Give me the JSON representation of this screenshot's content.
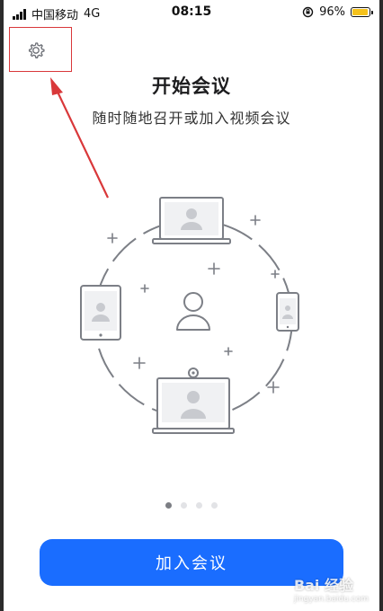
{
  "status_bar": {
    "carrier": "中国移动",
    "network": "4G",
    "time": "08:15",
    "battery_percent": "96%",
    "battery_level": 0.96
  },
  "header": {
    "settings_icon": "gear-icon"
  },
  "main": {
    "title": "开始会议",
    "subtitle": "随时随地召开或加入视频会议",
    "illustration_icons": [
      "laptop-icon",
      "tablet-icon",
      "phone-icon",
      "room-system-icon",
      "user-icon"
    ],
    "pager": {
      "count": 4,
      "active_index": 0
    },
    "join_button_label": "加入会议"
  },
  "colors": {
    "accent": "#1a6dff",
    "annotation": "#d9383a",
    "battery": "#f5c21b"
  },
  "watermark": {
    "brand": "Bai 经验",
    "url": "jingyan.baidu.com"
  }
}
